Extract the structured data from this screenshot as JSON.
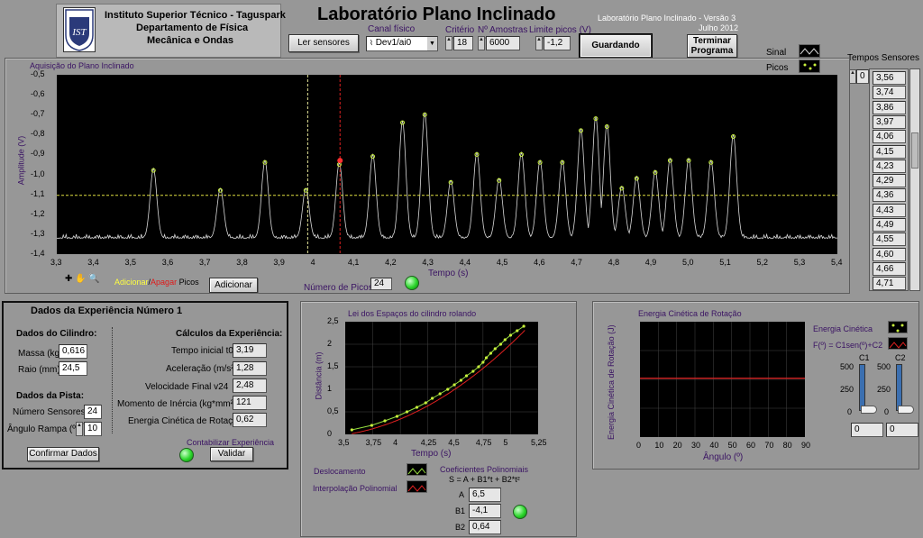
{
  "header": {
    "institute_line1": "Instituto Superior Técnico - Taguspark",
    "institute_line2": "Departamento de Física",
    "institute_line3": "Mecânica e Ondas",
    "logo_text": "IST",
    "title": "Laboratório Plano Inclinado",
    "version": "Laboratório Plano Inclinado - Versão 3",
    "date": "Julho 2012"
  },
  "toolbar": {
    "read_sensors": "Ler sensores",
    "channel_label": "Canal físico",
    "channel_value": "Dev1/ai0",
    "criterion_label": "Critério",
    "criterion_value": "18",
    "samples_label": "Nº Amostras",
    "samples_value": "6000",
    "peak_limit_label": "Limite picos (V)",
    "peak_limit_value": "-1,2",
    "saving": "Guardando",
    "terminate": "Terminar\nPrograma"
  },
  "legend": {
    "signal": "Sinal",
    "peaks": "Picos"
  },
  "sensor_times": {
    "title": "Tempos Sensores",
    "index": "0",
    "values": [
      "3,56",
      "3,74",
      "3,86",
      "3,97",
      "4,06",
      "4,15",
      "4,23",
      "4,29",
      "4,36",
      "4,43",
      "4,49",
      "4,55",
      "4,60",
      "4,66",
      "4,71"
    ]
  },
  "acquisition": {
    "title": "Aquisição do Plano Inclinado",
    "xlabel": "Tempo (s)",
    "ylabel": "Amplitude (V)",
    "add_label": "Adicionar",
    "delete_label": "Apagar",
    "peaks_word": " Picos",
    "add_button": "Adicionar",
    "npeaks_label": "Número de Picos",
    "npeaks_value": "24",
    "xticks": [
      "3,3",
      "3,4",
      "3,5",
      "3,6",
      "3,7",
      "3,8",
      "3,9",
      "4",
      "4,1",
      "4,2",
      "4,3",
      "4,4",
      "4,5",
      "4,6",
      "4,7",
      "4,8",
      "4,9",
      "5,0",
      "5,1",
      "5,2",
      "5,3",
      "5,4"
    ],
    "yticks": [
      "-0,5",
      "-0,6",
      "-0,7",
      "-0,8",
      "-0,9",
      "-1,0",
      "-1,1",
      "-1,2",
      "-1,3",
      "-1,4"
    ]
  },
  "experiment": {
    "title": "Dados da Experiência Número 1",
    "cyl_title": "Dados do Cilindro:",
    "mass_label": "Massa (kg)",
    "mass_value": "0,616",
    "radius_label": "Raio (mm)",
    "radius_value": "24,5",
    "track_title": "Dados da Pista:",
    "nsensors_label": "Número Sensores",
    "nsensors_value": "24",
    "angle_label": "Ângulo Rampa (º)",
    "angle_value": "10",
    "confirm": "Confirmar Dados",
    "calc_title": "Cálculos da Experiência:",
    "t0_label": "Tempo inicial t0",
    "t0_value": "3,19",
    "acc_label": "Aceleração (m/s²)",
    "acc_value": "1,28",
    "vf_label": "Velocidade Final v24",
    "vf_value": "2,48",
    "inertia_label": "Momento de Inércia (kg*mm²)",
    "inertia_value": "121",
    "ekr_label": "Energia Cinética de Rotação",
    "ekr_value": "0,62",
    "count_label": "Contabilizar Experiência",
    "validate": "Validar"
  },
  "spaces_chart": {
    "title": "Lei dos Espaços do cilindro rolando",
    "xlabel": "Tempo (s)",
    "ylabel": "Distância (m)",
    "xticks": [
      "3,5",
      "3,75",
      "4",
      "4,25",
      "4,5",
      "4,75",
      "5",
      "5,25"
    ],
    "yticks": [
      "2,5",
      "2",
      "1,5",
      "1",
      "0,5",
      "0"
    ],
    "leg_disp": "Deslocamento",
    "leg_interp": "Interpolação Polinomial",
    "coef_title": "Coeficientes Polinomiais",
    "coef_formula": "S = A + B1*t + B2*t²",
    "a_label": "A",
    "a_value": "6,5",
    "b1_label": "B1",
    "b1_value": "-4,1",
    "b2_label": "B2",
    "b2_value": "0,64"
  },
  "energy_chart": {
    "title": "Energia Cinética de Rotação",
    "xlabel": "Ângulo (º)",
    "ylabel": "Energia Cinética de Rotação (J)",
    "xticks": [
      "0",
      "10",
      "20",
      "30",
      "40",
      "50",
      "60",
      "70",
      "80",
      "90"
    ],
    "leg_energy": "Energia Cinética",
    "leg_fit": "F(º) = C1sen(º)+C2",
    "c1_label": "C1",
    "c2_label": "C2",
    "slider_ticks": [
      "500",
      "250",
      "0"
    ],
    "c1_value": "0",
    "c2_value": "0"
  },
  "colors": {
    "plot_bg": "#000000",
    "signal": "#d8d8d8",
    "peak_marker": "#c8f03c",
    "threshold": "#e0e040",
    "cursor_white": "#e8e89a",
    "cursor_red": "#e02020",
    "led": "#2bd62b"
  },
  "chart_data": [
    {
      "type": "line",
      "title": "Aquisição do Plano Inclinado",
      "xlabel": "Tempo (s)",
      "ylabel": "Amplitude (V)",
      "xlim": [
        3.3,
        5.4
      ],
      "ylim": [
        -1.4,
        -0.5
      ],
      "threshold": -1.2,
      "peaks": {
        "x": [
          3.56,
          3.74,
          3.86,
          3.97,
          4.06,
          4.15,
          4.23,
          4.29,
          4.36,
          4.43,
          4.49,
          4.55,
          4.6,
          4.66,
          4.71,
          4.75,
          4.78,
          4.82,
          4.86,
          4.91,
          4.95,
          5.0,
          5.06,
          5.12
        ],
        "y": [
          -1.0,
          -1.1,
          -0.96,
          -1.1,
          -0.97,
          -0.93,
          -0.76,
          -0.72,
          -1.06,
          -0.92,
          -1.05,
          -0.92,
          -0.96,
          -0.96,
          -0.8,
          -0.74,
          -0.78,
          -1.09,
          -1.04,
          -1.01,
          -0.95,
          -0.95,
          -0.96,
          -0.83
        ]
      },
      "baseline": -1.32
    },
    {
      "type": "scatter",
      "title": "Lei dos Espaços do cilindro rolando",
      "xlabel": "Tempo (s)",
      "ylabel": "Distância (m)",
      "xlim": [
        3.5,
        5.25
      ],
      "ylim": [
        0,
        2.5
      ],
      "x": [
        3.56,
        3.74,
        3.86,
        3.97,
        4.06,
        4.15,
        4.23,
        4.29,
        4.36,
        4.43,
        4.49,
        4.55,
        4.6,
        4.66,
        4.71,
        4.75,
        4.78,
        4.82,
        4.86,
        4.91,
        4.95,
        5.0,
        5.06,
        5.12
      ],
      "y": [
        0.1,
        0.2,
        0.3,
        0.4,
        0.5,
        0.6,
        0.7,
        0.8,
        0.9,
        1.0,
        1.1,
        1.2,
        1.3,
        1.4,
        1.5,
        1.6,
        1.7,
        1.8,
        1.9,
        2.0,
        2.1,
        2.2,
        2.3,
        2.4
      ],
      "fit": {
        "A": 6.5,
        "B1": -4.1,
        "B2": 0.64
      }
    },
    {
      "type": "line",
      "title": "Energia Cinética de Rotação",
      "xlabel": "Ângulo (º)",
      "ylabel": "Energia Cinética de Rotação (J)",
      "xlim": [
        0,
        90
      ],
      "series": [
        {
          "values": [
            0,
            0
          ]
        }
      ]
    }
  ]
}
